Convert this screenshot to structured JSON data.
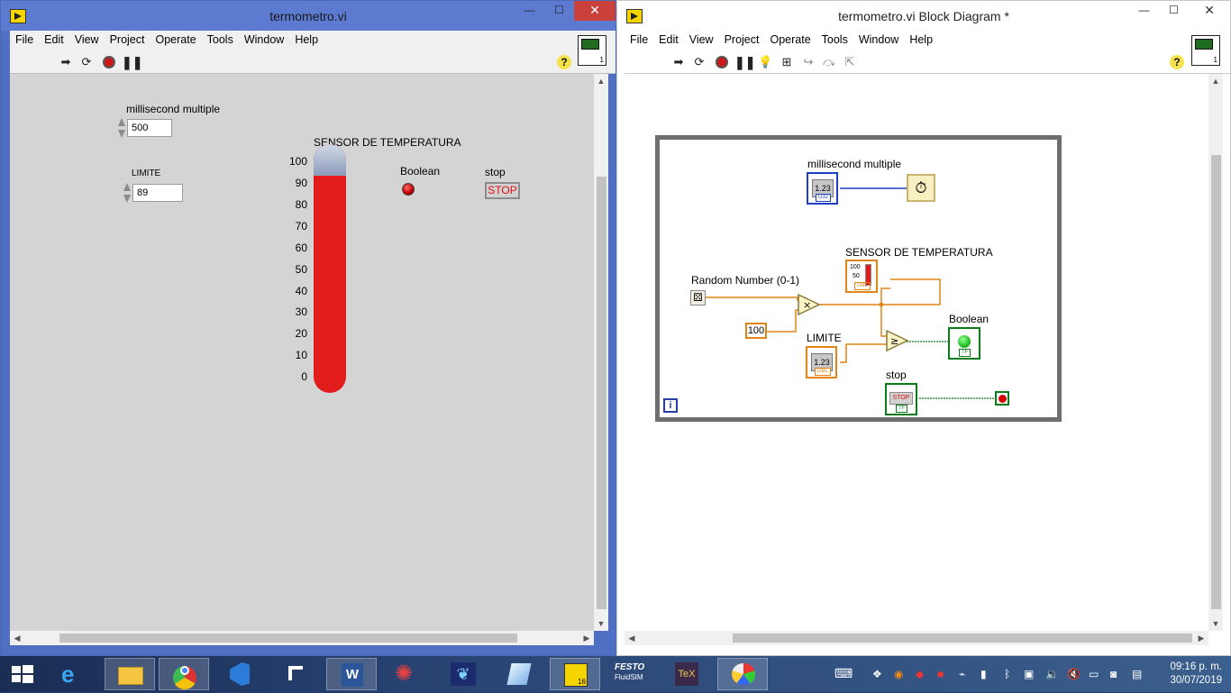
{
  "front_panel": {
    "title": "termometro.vi",
    "menu": [
      "File",
      "Edit",
      "View",
      "Project",
      "Operate",
      "Tools",
      "Window",
      "Help"
    ],
    "vi_icon_label": "1",
    "controls": {
      "ms_label": "millisecond multiple",
      "ms_value": "500",
      "limite_label": "LIMITE",
      "limite_value": "89",
      "thermo_label": "SENSOR DE TEMPERATURA",
      "thermo_scale": [
        "100",
        "90",
        "80",
        "70",
        "60",
        "50",
        "40",
        "30",
        "20",
        "10",
        "0"
      ],
      "thermo_value": 93,
      "boolean_label": "Boolean",
      "stop_label": "stop",
      "stop_button": "STOP"
    },
    "colors": {
      "thermo_fill": "#e21c1c",
      "led_on": "#d00000"
    }
  },
  "block_diagram": {
    "title": "termometro.vi Block Diagram *",
    "menu": [
      "File",
      "Edit",
      "View",
      "Project",
      "Operate",
      "Tools",
      "Window",
      "Help"
    ],
    "vi_icon_label": "1",
    "nodes": {
      "ms_label": "millisecond multiple",
      "ms_terminal": "1.23",
      "ms_type": "U32",
      "sensor_label": "SENSOR DE TEMPERATURA",
      "sensor_ticks": [
        "100",
        "50"
      ],
      "sensor_type": "DBL",
      "random_label": "Random Number (0-1)",
      "const_100": "100",
      "limite_label": "LIMITE",
      "limite_terminal": "1.23",
      "limite_type": "DBL",
      "boolean_label": "Boolean",
      "boolean_type": "TF",
      "stop_label": "stop",
      "stop_terminal": "STOP",
      "stop_type": "TF",
      "loop_iter": "i",
      "multiply_symbol": "×",
      "compare_symbol": "≥"
    },
    "colors": {
      "int_wire": "#1f3fbf",
      "dbl_wire": "#e28418",
      "bool_wire": "#0a7a1a"
    }
  },
  "taskbar": {
    "time": "09:16 p. m.",
    "date": "30/07/2019",
    "apps": [
      "windows-start",
      "internet-explorer",
      "file-explorer",
      "chrome",
      "visual-studio-code",
      "notepad",
      "word",
      "spider-app",
      "butterfly-app",
      "glass-app",
      "labview",
      "festo-fluidsim",
      "tex",
      "paint"
    ],
    "labels": {
      "festo": "FESTO",
      "fluidsim": "FluidSIM",
      "tex": "TeX",
      "word": "W",
      "labview_badge": "16"
    }
  }
}
